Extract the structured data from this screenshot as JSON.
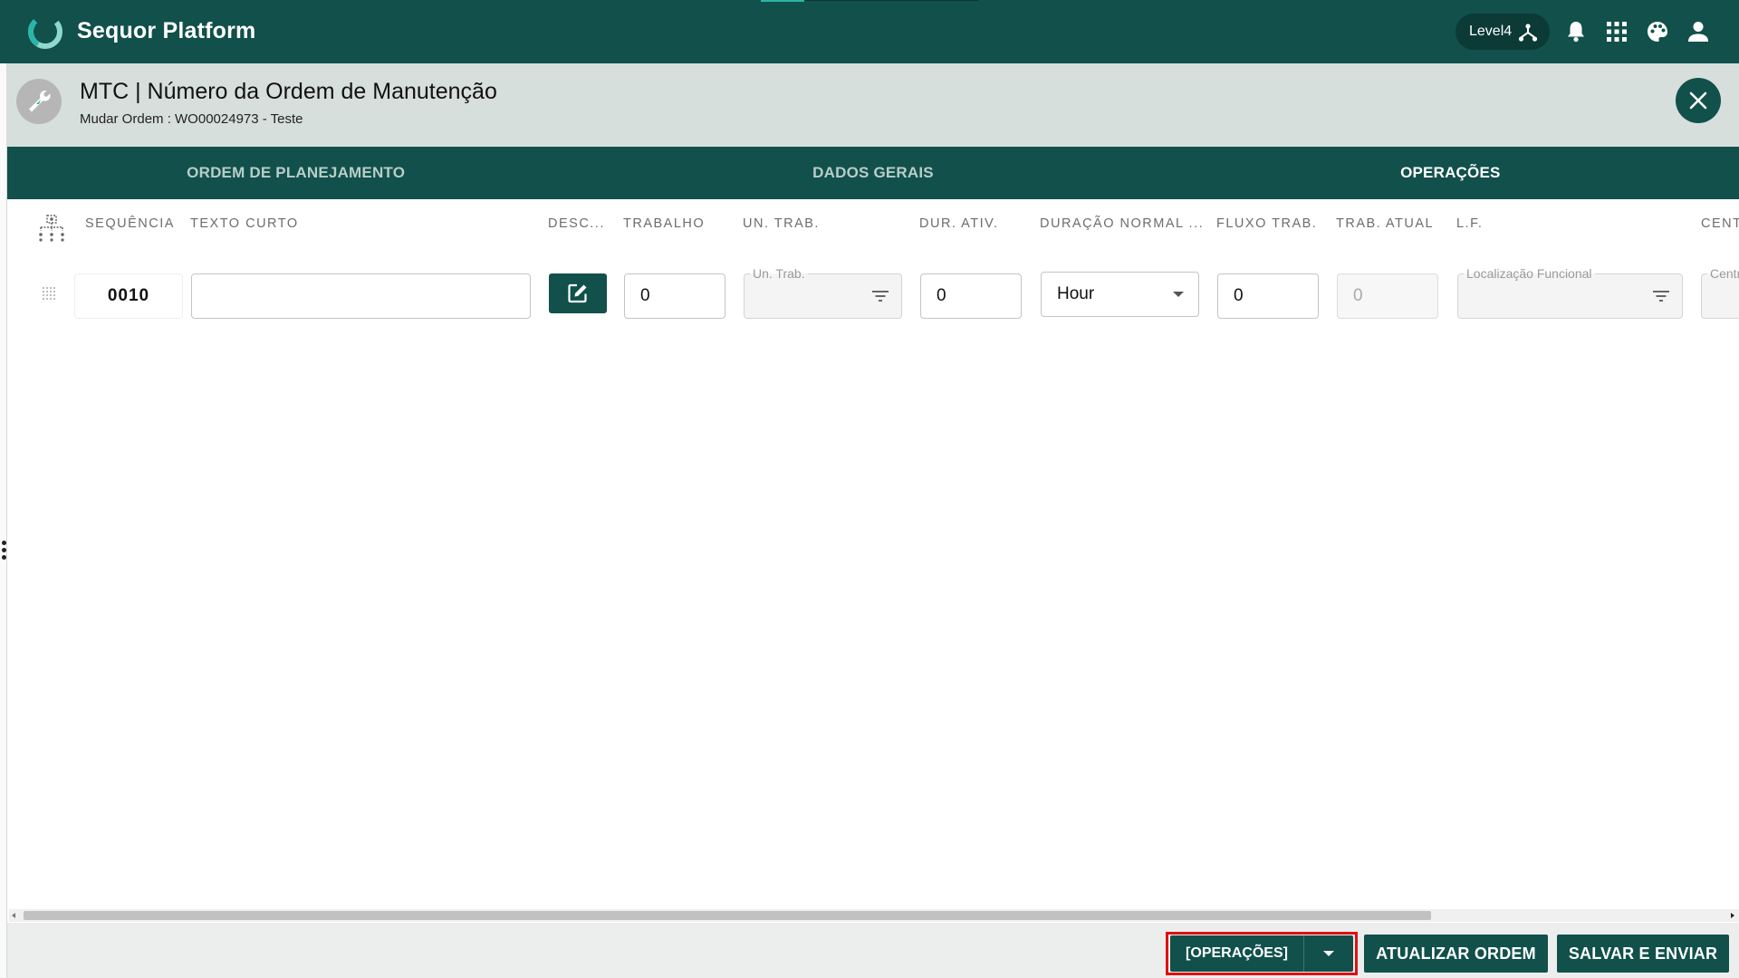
{
  "app": {
    "title": "Sequor Platform",
    "level_label": "Level4"
  },
  "header": {
    "title": "MTC | Número da Ordem de Manutenção",
    "subtitle": "Mudar Ordem : WO00024973 - Teste"
  },
  "tabs": [
    {
      "label": "ORDEM DE PLANEJAMENTO",
      "active": false
    },
    {
      "label": "DADOS GERAIS",
      "active": false
    },
    {
      "label": "OPERAÇÕES",
      "active": true
    }
  ],
  "columns": {
    "sequencia": "SEQUÊNCIA",
    "texto_curto": "TEXTO CURTO",
    "desc": "DESC...",
    "trabalho": "TRABALHO",
    "un_trab": "UN. TRAB.",
    "dur_ativ": "DUR. ATIV.",
    "duracao_normal": "DURAÇÃO NORMAL ...",
    "fluxo_trab": "FLUXO TRAB.",
    "trab_atual": "TRAB. ATUAL",
    "lf": "L.F.",
    "cent": "CENT"
  },
  "row": {
    "sequencia": "0010",
    "texto_curto": "",
    "trabalho": "0",
    "un_trab_label": "Un. Trab.",
    "dur_ativ": "0",
    "duracao_normal": "Hour",
    "fluxo_trab": "0",
    "trab_atual": "0",
    "lf_label": "Localização Funcional",
    "cent_label": "Centr"
  },
  "footer": {
    "split_label": "[OPERAÇÕES]",
    "update_label": "ATUALIZAR ORDEM",
    "save_label": "SALVAR E ENVIAR"
  },
  "colors": {
    "primary": "#11504b",
    "header_bg": "#d7dfdc",
    "accent": "#2bb5a6",
    "highlight_outline": "#e01010"
  },
  "icons": [
    "sequor-logo-icon",
    "hierarchy-icon",
    "bell-icon",
    "apps-grid-icon",
    "palette-icon",
    "user-icon",
    "wrench-icon",
    "close-icon",
    "tree-icon",
    "drag-handle-icon",
    "edit-icon",
    "filter-icon",
    "chevron-down-icon"
  ]
}
